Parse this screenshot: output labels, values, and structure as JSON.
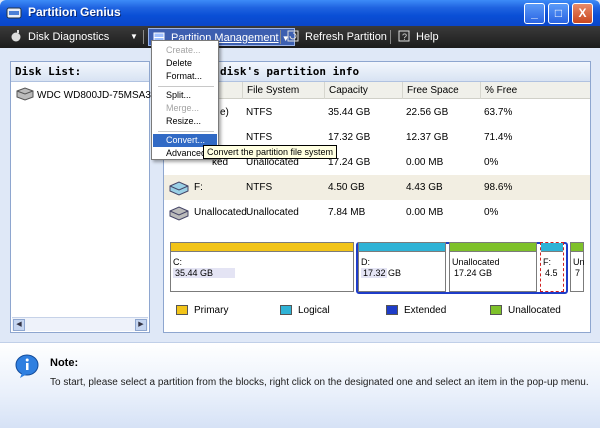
{
  "window": {
    "title": "Partition Genius",
    "controls": [
      "_",
      "□",
      "X"
    ]
  },
  "toolbar": {
    "items": [
      {
        "label": "Disk Diagnostics",
        "icon": "bomb-icon"
      },
      {
        "label": "Partition Management",
        "icon": "partition-icon"
      },
      {
        "label": "Refresh Partition",
        "icon": "refresh-icon"
      },
      {
        "label": "Help",
        "icon": "help-icon"
      }
    ]
  },
  "menu": {
    "items": [
      {
        "label": "Create...",
        "enabled": false
      },
      {
        "label": "Delete",
        "enabled": true
      },
      {
        "label": "Format...",
        "enabled": true
      },
      {
        "label": "Split...",
        "enabled": true
      },
      {
        "label": "Merge...",
        "enabled": false
      },
      {
        "label": "Resize...",
        "enabled": true
      },
      {
        "label": "Convert...",
        "enabled": true,
        "highlighted": true
      },
      {
        "label": "Advanced",
        "enabled": true
      }
    ],
    "tooltip": "Convert the partition file system"
  },
  "disk_list": {
    "title": "Disk List:",
    "disks": [
      "WDC WD800JD-75MSA3"
    ]
  },
  "partition_info": {
    "title": "disk's partition info",
    "columns": [
      "File System",
      "Capacity",
      "Free Space",
      "% Free"
    ],
    "rows": [
      {
        "name": "e)",
        "fs": "NTFS",
        "capacity": "35.44 GB",
        "free": "22.56 GB",
        "pct": "63.7%"
      },
      {
        "name": "",
        "fs": "NTFS",
        "capacity": "17.32 GB",
        "free": "12.37 GB",
        "pct": "71.4%"
      },
      {
        "name": "ked",
        "fs": "Unallocated",
        "capacity": "17.24 GB",
        "free": "0.00 MB",
        "pct": "0%"
      },
      {
        "name": "F:",
        "fs": "NTFS",
        "capacity": "4.50 GB",
        "free": "4.43 GB",
        "pct": "98.6%",
        "selected": true
      },
      {
        "name": "Unallocated",
        "fs": "Unallocated",
        "capacity": "7.84 MB",
        "free": "0.00 MB",
        "pct": "0%"
      }
    ]
  },
  "blocks": [
    {
      "label": "C:",
      "size": "35.44 GB",
      "type": "primary"
    },
    {
      "label": "D:",
      "size": "17.32 GB",
      "type": "logical"
    },
    {
      "label": "Unallocated",
      "size": "17.24 GB",
      "type": "unallocated"
    },
    {
      "label": "F:",
      "size": "4.5",
      "type": "logical"
    },
    {
      "label": "Un",
      "size": "7",
      "type": "unallocated"
    }
  ],
  "legend": [
    {
      "label": "Primary",
      "color": "#f2c419"
    },
    {
      "label": "Logical",
      "color": "#2fb3d6"
    },
    {
      "label": "Extended",
      "color": "#1e3cc8"
    },
    {
      "label": "Unallocated",
      "color": "#7ec12a"
    }
  ],
  "note": {
    "title": "Note:",
    "text": "To start, please select a partition from the blocks, right click on the designated one and select an item in the pop-up menu."
  }
}
